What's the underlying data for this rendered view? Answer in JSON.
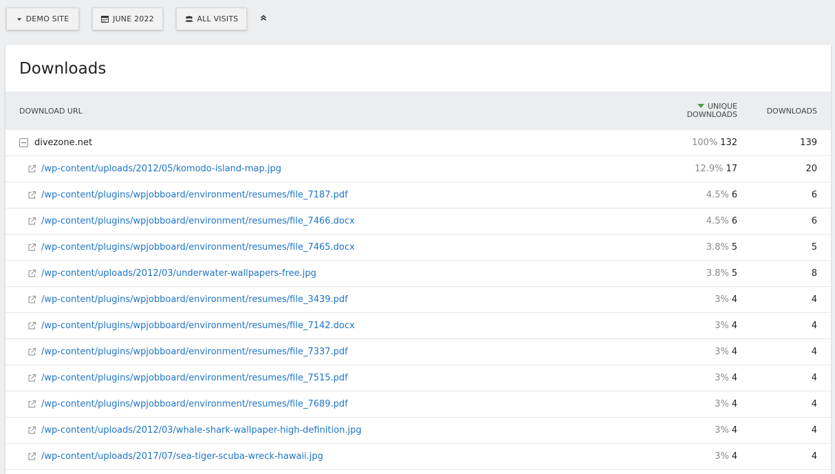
{
  "toolbar": {
    "site_label": "DEMO SITE",
    "period_label": "JUNE 2022",
    "segment_label": "ALL VISITS"
  },
  "report": {
    "title": "Downloads",
    "columns": {
      "url": "DOWNLOAD URL",
      "unique_line1": "UNIQUE",
      "unique_line2": "DOWNLOADS",
      "downloads": "DOWNLOADS"
    },
    "group": {
      "label": "divezone.net",
      "unique_pct": "100%",
      "unique": "132",
      "downloads": "139"
    },
    "rows": [
      {
        "url": "/wp-content/uploads/2012/05/komodo-island-map.jpg",
        "unique_pct": "12.9%",
        "unique": "17",
        "downloads": "20"
      },
      {
        "url": "/wp-content/plugins/wpjobboard/environment/resumes/file_7187.pdf",
        "unique_pct": "4.5%",
        "unique": "6",
        "downloads": "6"
      },
      {
        "url": "/wp-content/plugins/wpjobboard/environment/resumes/file_7466.docx",
        "unique_pct": "4.5%",
        "unique": "6",
        "downloads": "6"
      },
      {
        "url": "/wp-content/plugins/wpjobboard/environment/resumes/file_7465.docx",
        "unique_pct": "3.8%",
        "unique": "5",
        "downloads": "5"
      },
      {
        "url": "/wp-content/uploads/2012/03/underwater-wallpapers-free.jpg",
        "unique_pct": "3.8%",
        "unique": "5",
        "downloads": "8"
      },
      {
        "url": "/wp-content/plugins/wpjobboard/environment/resumes/file_3439.pdf",
        "unique_pct": "3%",
        "unique": "4",
        "downloads": "4"
      },
      {
        "url": "/wp-content/plugins/wpjobboard/environment/resumes/file_7142.docx",
        "unique_pct": "3%",
        "unique": "4",
        "downloads": "4"
      },
      {
        "url": "/wp-content/plugins/wpjobboard/environment/resumes/file_7337.pdf",
        "unique_pct": "3%",
        "unique": "4",
        "downloads": "4"
      },
      {
        "url": "/wp-content/plugins/wpjobboard/environment/resumes/file_7515.pdf",
        "unique_pct": "3%",
        "unique": "4",
        "downloads": "4"
      },
      {
        "url": "/wp-content/plugins/wpjobboard/environment/resumes/file_7689.pdf",
        "unique_pct": "3%",
        "unique": "4",
        "downloads": "4"
      },
      {
        "url": "/wp-content/uploads/2012/03/whale-shark-wallpaper-high-definition.jpg",
        "unique_pct": "3%",
        "unique": "4",
        "downloads": "4"
      },
      {
        "url": "/wp-content/uploads/2017/07/sea-tiger-scuba-wreck-hawaii.jpg",
        "unique_pct": "3%",
        "unique": "4",
        "downloads": "4"
      }
    ]
  },
  "icons": {
    "site": "caret-down-icon",
    "period": "calendar-icon",
    "segment": "users-icon",
    "collapse": "double-chevron-up-icon",
    "group": "collapse-box-icon",
    "row": "external-link-icon"
  },
  "colors": {
    "link": "#1e74c8",
    "sort_arrow": "#43a047",
    "header_bg": "#ebedf0"
  }
}
